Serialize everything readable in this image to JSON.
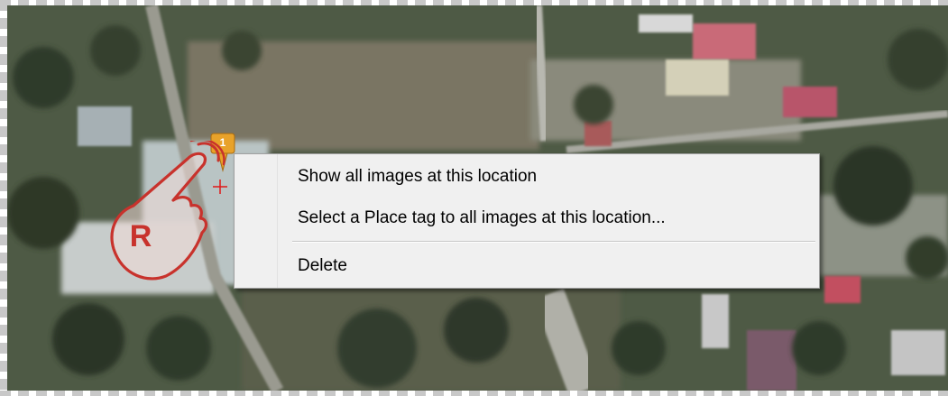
{
  "map": {
    "marker_number": "1",
    "gesture_letter": "R"
  },
  "context_menu": {
    "items": [
      {
        "label": "Show all images at this location"
      },
      {
        "label": "Select a Place tag to all images at this location..."
      },
      {
        "label": "Delete"
      }
    ]
  },
  "colors": {
    "marker": "#e8a22a",
    "gesture": "#c8322c",
    "menu_background": "#f0f0f0"
  },
  "icons": {
    "marker": "map-marker-icon",
    "gesture": "right-click-hand-icon",
    "crosshair": "crosshair-icon"
  }
}
